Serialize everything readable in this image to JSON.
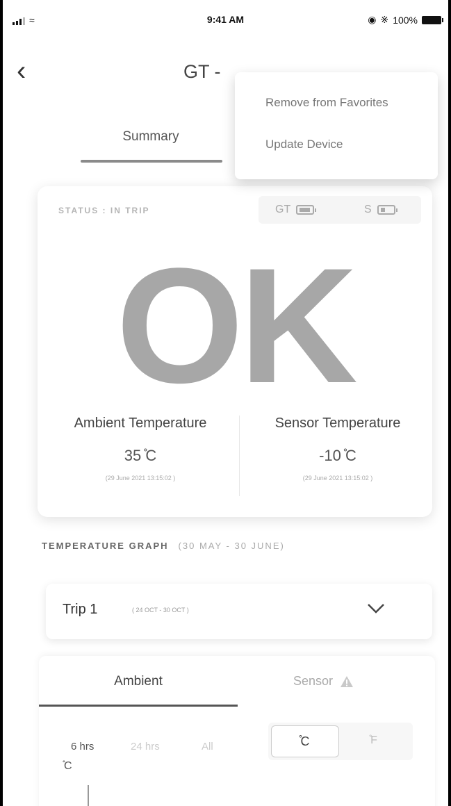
{
  "status_bar": {
    "time": "9:41 AM",
    "battery": "100%"
  },
  "header": {
    "back_icon": "chevron-left-icon",
    "title": "GT -"
  },
  "tabs": {
    "summary": "Summary"
  },
  "menu": {
    "items": [
      "Remove from Favorites",
      "Update Device"
    ]
  },
  "status_card": {
    "status_label": "STATUS : IN TRIP",
    "gt_label": "GT",
    "s_label": "S",
    "gt_battery_level": 0.75,
    "s_battery_level": 0.3,
    "big_status": "OK",
    "ambient": {
      "label": "Ambient Temperature",
      "value": "35 ̊C",
      "timestamp": "(29 June 2021   13:15:02 )"
    },
    "sensor": {
      "label": "Sensor Temperature",
      "value": "-10 ̊C",
      "timestamp": "(29 June 2021   13:15:02 )"
    }
  },
  "graph": {
    "label": "TEMPERATURE GRAPH",
    "range": "(30 MAY - 30 JUNE)"
  },
  "trip": {
    "name": "Trip 1",
    "range": "( 24 OCT - 30 OCT )"
  },
  "graph_tabs": {
    "ambient": "Ambient",
    "sensor": "Sensor"
  },
  "time_ranges": [
    "6 hrs",
    "24 hrs",
    "All"
  ],
  "units": {
    "c": " ̊C",
    "f": " ̊F"
  },
  "axis_unit": " ̊C",
  "colors": {
    "accent": "#a7a7a7",
    "text": "#444444"
  }
}
